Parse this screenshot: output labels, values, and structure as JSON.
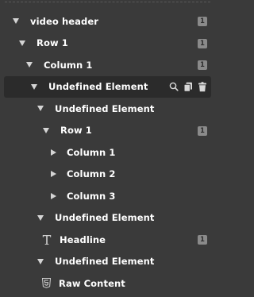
{
  "tree": {
    "items": [
      {
        "label": "video header",
        "badge": "1"
      },
      {
        "label": "Row 1",
        "badge": "1"
      },
      {
        "label": "Column 1",
        "badge": "1"
      },
      {
        "label": "Undefined Element",
        "selected": true
      },
      {
        "label": "Undefined Element"
      },
      {
        "label": "Row 1",
        "badge": "1"
      },
      {
        "label": "Column 1"
      },
      {
        "label": "Column 2"
      },
      {
        "label": "Column 3"
      },
      {
        "label": "Undefined Element"
      },
      {
        "label": "Headline",
        "icon": "text-t-icon",
        "badge": "1"
      },
      {
        "label": "Undefined Element"
      },
      {
        "label": "Raw Content",
        "icon": "html5-icon"
      }
    ]
  },
  "colors": {
    "background": "#3a3a3a",
    "selected_row": "#2b2b2b",
    "text": "#ffffff",
    "caret": "#d4d4d4",
    "badge": "#8a8a8a"
  },
  "row_actions": [
    "search-icon",
    "duplicate-icon",
    "trash-icon"
  ]
}
